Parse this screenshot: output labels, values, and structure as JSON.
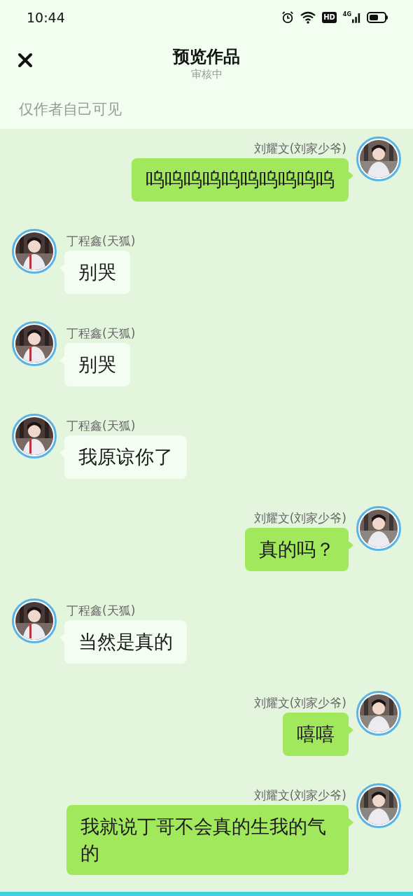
{
  "status_bar": {
    "time": "10:44",
    "hd_badge": "HD",
    "network": "4G"
  },
  "header": {
    "title": "预览作品",
    "subtitle": "审核中"
  },
  "notice": "仅作者自己可见",
  "messages": [
    {
      "kind": "sent",
      "sender": "刘耀文(刘家少爷)",
      "text": "呜呜呜呜呜呜呜呜呜呜"
    },
    {
      "kind": "received",
      "sender": "丁程鑫(天狐)",
      "text": "别哭"
    },
    {
      "kind": "received",
      "sender": "丁程鑫(天狐)",
      "text": "别哭"
    },
    {
      "kind": "received",
      "sender": "丁程鑫(天狐)",
      "text": "我原谅你了"
    },
    {
      "kind": "sent",
      "sender": "刘耀文(刘家少爷)",
      "text": "真的吗？"
    },
    {
      "kind": "received",
      "sender": "丁程鑫(天狐)",
      "text": "当然是真的"
    },
    {
      "kind": "sent",
      "sender": "刘耀文(刘家少爷)",
      "text": "嘻嘻"
    },
    {
      "kind": "sent",
      "sender": "刘耀文(刘家少爷)",
      "text": "我就说丁哥不会真的生我的气的"
    }
  ]
}
